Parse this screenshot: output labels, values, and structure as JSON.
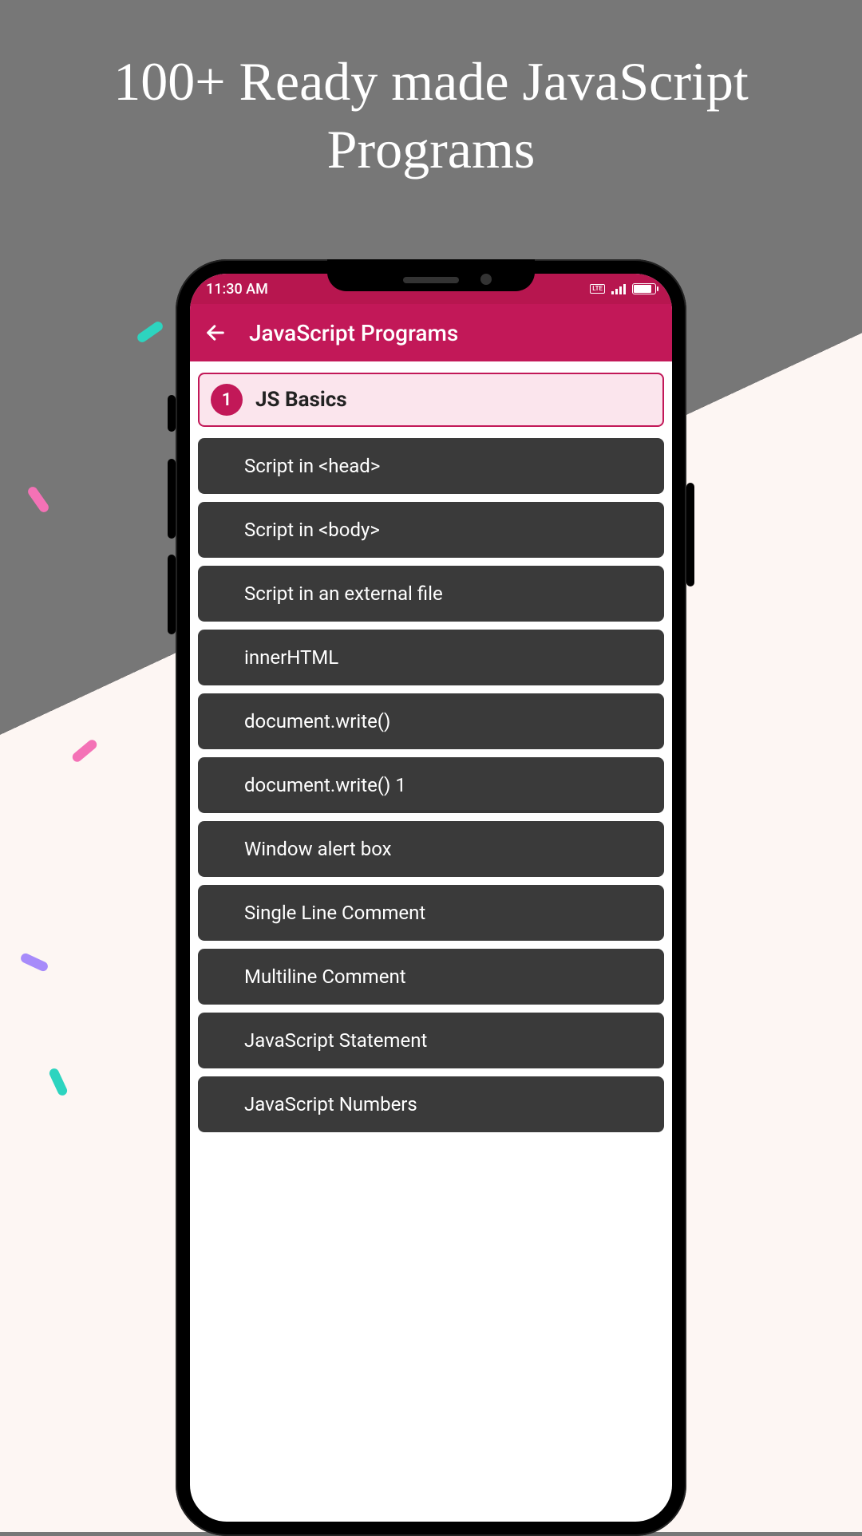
{
  "hero": {
    "title": "100+ Ready made JavaScript Programs"
  },
  "statusBar": {
    "time": "11:30 AM",
    "batteryPercent": "81"
  },
  "appBar": {
    "title": "JavaScript Programs"
  },
  "section": {
    "number": "1",
    "title": "JS Basics"
  },
  "items": [
    "Script in <head>",
    "Script in <body>",
    "Script in an external file",
    "innerHTML",
    "document.write()",
    "document.write() 1",
    "Window alert box",
    "Single Line Comment",
    "Multiline Comment",
    "JavaScript Statement",
    "JavaScript Numbers"
  ],
  "colors": {
    "accent": "#c21858",
    "accentDark": "#b7164f",
    "headerBg": "#fbe5ed",
    "itemBg": "#3a3a3a",
    "promoBg": "#777777"
  }
}
